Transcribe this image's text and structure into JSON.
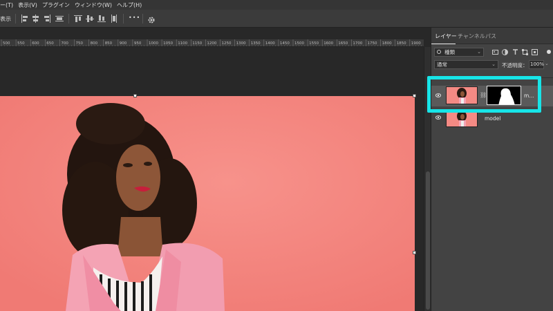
{
  "menubar": {
    "items": [
      "ー(T)",
      "表示(V)",
      "プラグイン",
      "ウィンドウ(W)",
      "ヘルプ(H)"
    ]
  },
  "options_bar": {
    "label": "表示",
    "more_label": "•••"
  },
  "ruler": {
    "ticks": [
      "500",
      "550",
      "600",
      "650",
      "700",
      "750",
      "800",
      "850",
      "900",
      "950",
      "1000",
      "1050",
      "1100",
      "1150",
      "1200",
      "1250",
      "1300",
      "1350",
      "1400",
      "1450",
      "1500",
      "1550",
      "1600",
      "1650",
      "1700",
      "1750",
      "1800",
      "1850",
      "1900"
    ]
  },
  "layers_panel": {
    "tabs": [
      "レイヤー",
      "チャンネル",
      "パス"
    ],
    "active_tab": "レイヤー",
    "filter_kind": "種類",
    "blend_mode": "通常",
    "opacity_label": "不透明度：",
    "opacity_value": "100%",
    "layers": [
      {
        "name": "m...",
        "selected": true,
        "has_mask": true,
        "visible": true
      },
      {
        "name": "model",
        "selected": false,
        "has_mask": false,
        "visible": true
      }
    ]
  },
  "colors": {
    "highlight": "#17e5e8",
    "photo_background": "#f48a84",
    "jacket": "#f4a3b4"
  }
}
